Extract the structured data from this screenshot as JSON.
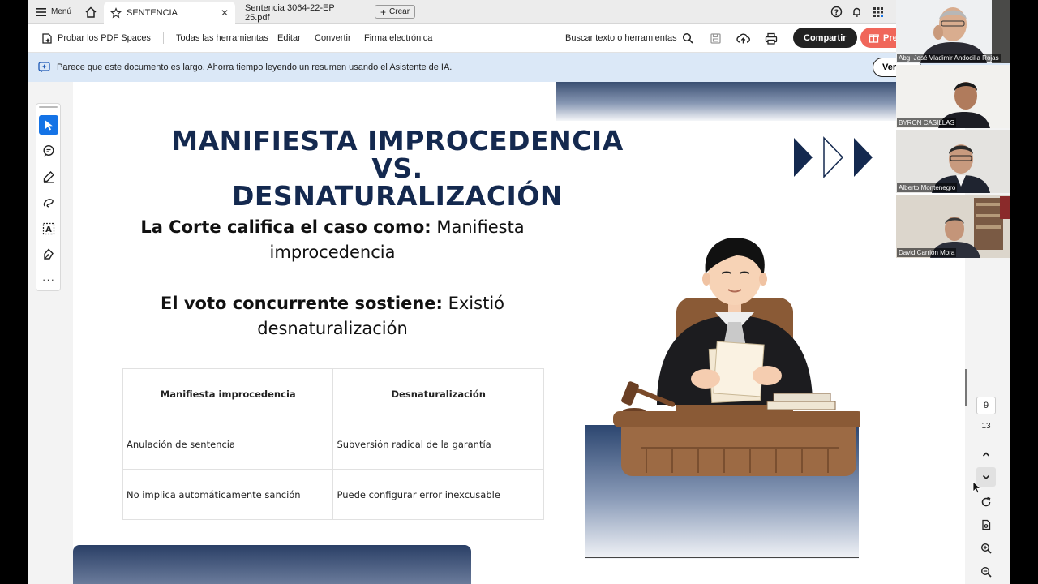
{
  "tabbar": {
    "menu_label": "Menú",
    "tabs": [
      {
        "label": "SENTENCIA"
      },
      {
        "label": "Sentencia 3064-22-EP 25.pdf"
      }
    ],
    "create_label": "Crear"
  },
  "toolbar": {
    "spaces_label": "Probar los PDF Spaces",
    "all_tools_label": "Todas las herramientas",
    "edit_label": "Editar",
    "convert_label": "Convertir",
    "esign_label": "Firma electrónica",
    "search_label": "Buscar texto o herramientas",
    "share_label": "Compartir",
    "premium_label": "Pre"
  },
  "banner": {
    "text": "Parece que este documento es largo. Ahorra tiempo leyendo un resumen usando el Asistente de IA.",
    "button_label": "Ver"
  },
  "slide": {
    "title_line1": "MANIFIESTA IMPROCEDENCIA VS.",
    "title_line2": "DESNATURALIZACIÓN",
    "court_bold": "La Corte califica el caso como:",
    "court_rest": " Manifiesta improcedencia",
    "vote_bold": "El voto concurrente sostiene:",
    "vote_rest": " Existió desnaturalización",
    "table": {
      "headers": [
        "Manifiesta improcedencia",
        "Desnaturalización"
      ],
      "rows": [
        [
          "Anulación de sentencia",
          "Subversión radical de la garantía"
        ],
        [
          "No implica automáticamente sanción",
          "Puede configurar error inexcusable"
        ]
      ]
    }
  },
  "nav": {
    "current_page": "9",
    "total_pages": "13"
  },
  "participants": [
    {
      "name": "Abg. José Vladimir Andocilla Rojas"
    },
    {
      "name": "BYRON CASILLAS"
    },
    {
      "name": "Alberto Montenegro"
    },
    {
      "name": "David Carrión Mora"
    }
  ],
  "colors": {
    "accent_blue": "#1473e6",
    "title_navy": "#14294f",
    "premium": "#f0665a"
  }
}
